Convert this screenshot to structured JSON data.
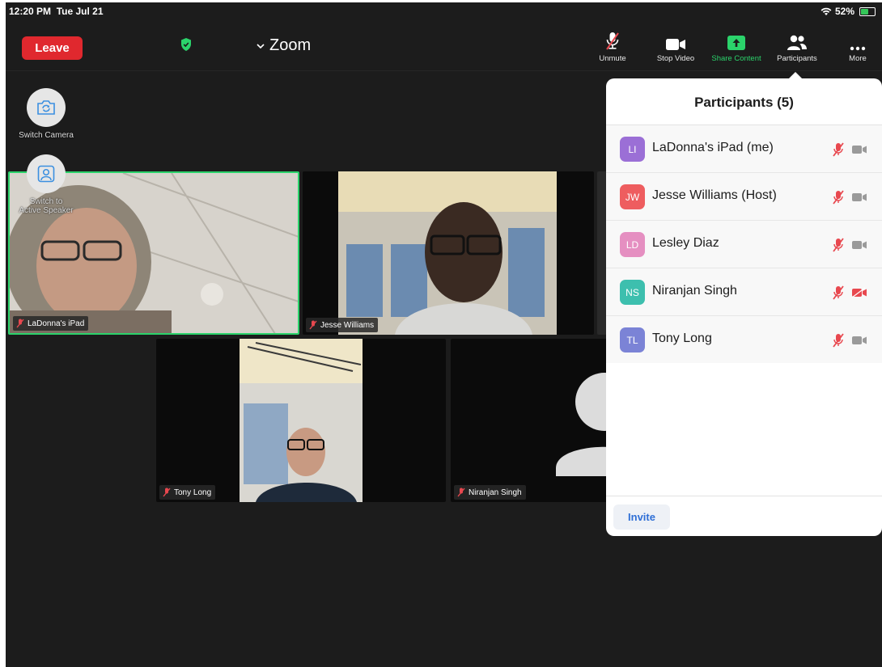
{
  "status_bar": {
    "time": "12:20 PM",
    "date": "Tue Jul 21",
    "battery": "52%"
  },
  "header": {
    "leave_label": "Leave",
    "meeting_title": "Zoom",
    "tools": [
      {
        "label": "Unmute",
        "icon": "mic-muted-icon"
      },
      {
        "label": "Stop Video",
        "icon": "video-camera-icon"
      },
      {
        "label": "Share Content",
        "icon": "share-screen-icon"
      },
      {
        "label": "Participants",
        "icon": "participants-icon"
      },
      {
        "label": "More",
        "icon": "more-dots-icon"
      }
    ]
  },
  "side_controls": {
    "switch_camera": "Switch Camera",
    "switch_speaker_line1": "Switch to",
    "switch_speaker_line2": "Active Speaker"
  },
  "video_tiles": [
    {
      "name": "LaDonna's iPad",
      "muted": true,
      "active_speaker": true
    },
    {
      "name": "Jesse Williams",
      "muted": true
    },
    {
      "name": "Tony Long",
      "muted": true
    },
    {
      "name": "Niranjan Singh",
      "muted": true,
      "video_off": true
    }
  ],
  "participants_panel": {
    "title": "Participants (5)",
    "invite_label": "Invite",
    "participants": [
      {
        "initials": "LI",
        "name": "LaDonna's iPad (me)",
        "color": "#9b6fd6",
        "mic_muted": true,
        "video_off": false
      },
      {
        "initials": "JW",
        "name": "Jesse Williams (Host)",
        "color": "#ee5d5f",
        "mic_muted": true,
        "video_off": false
      },
      {
        "initials": "LD",
        "name": "Lesley Diaz",
        "color": "#e58fc1",
        "mic_muted": true,
        "video_off": false
      },
      {
        "initials": "NS",
        "name": "Niranjan Singh",
        "color": "#3dbfae",
        "mic_muted": true,
        "video_off": true
      },
      {
        "initials": "TL",
        "name": "Tony Long",
        "color": "#7b83d6",
        "mic_muted": true,
        "video_off": false
      }
    ]
  },
  "colors": {
    "accent_green": "#2bd36b",
    "leave_red": "#e0282e",
    "mute_red": "#e8484f",
    "invite_blue": "#2f6fd6"
  }
}
